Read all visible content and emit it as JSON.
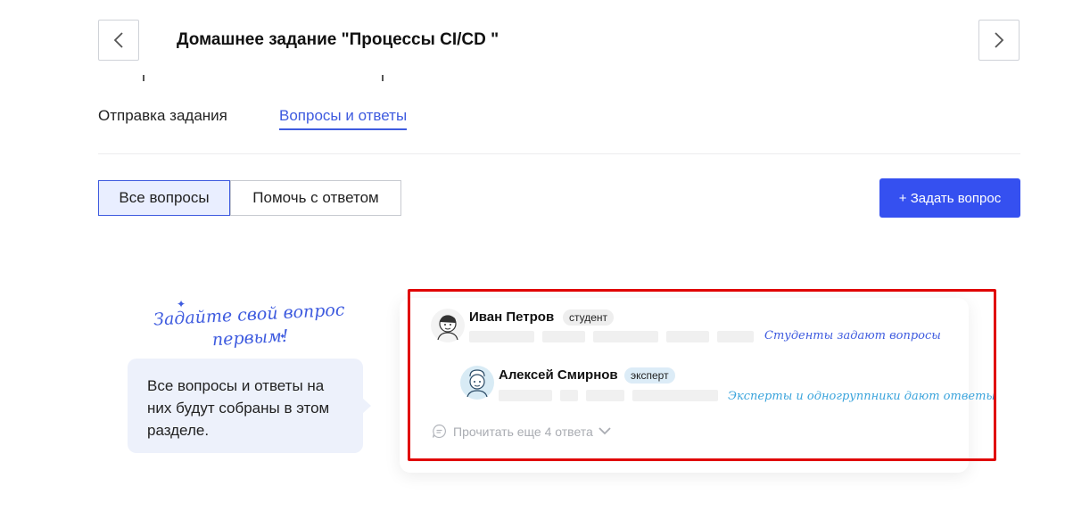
{
  "header": {
    "title": "Домашнее задание \"Процессы CI/CD \"",
    "prev_icon": "chevron-left-icon",
    "next_icon": "chevron-right-icon"
  },
  "tabs": [
    {
      "label": "Отправка задания",
      "active": false
    },
    {
      "label": "Вопросы и ответы",
      "active": true
    }
  ],
  "filters": {
    "all_label": "Все вопросы",
    "help_label": "Помочь с ответом",
    "ask_label": "+ Задать вопрос"
  },
  "promo": {
    "handwritten": "Задайте свой вопрос первым!",
    "bubble_text": "Все вопросы и ответы на них будут собраны в этом разделе."
  },
  "illustration": {
    "student_name": "Иван Петров",
    "student_role": "студент",
    "student_note": "Студенты задают вопросы",
    "expert_name": "Алексей Смирнов",
    "expert_role": "эксперт",
    "expert_note": "Эксперты и одногруппники дают ответы",
    "more_label": "Прочитать еще 4 ответа"
  },
  "colors": {
    "accent": "#3e5bdf",
    "button": "#3550f0",
    "frame": "#e00000",
    "expert_note": "#3ba4dc"
  }
}
